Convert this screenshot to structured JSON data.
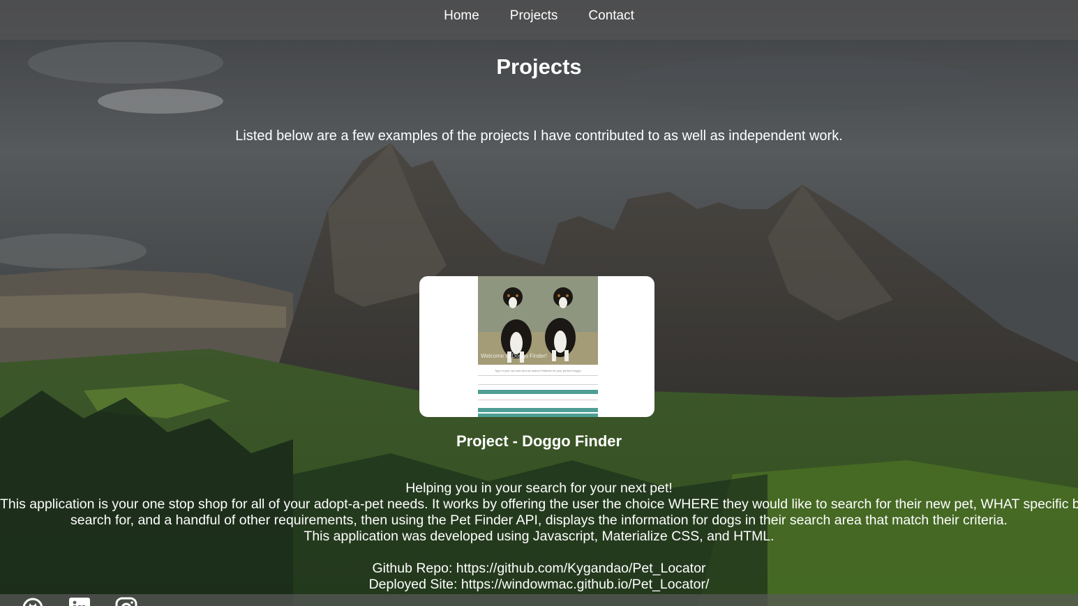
{
  "nav": {
    "items": [
      {
        "label": "Home"
      },
      {
        "label": "Projects"
      },
      {
        "label": "Contact"
      }
    ]
  },
  "page": {
    "title": "Projects",
    "intro": "Listed below are a few examples of the projects I have contributed to as well as independent work."
  },
  "project": {
    "name": "Project - Doggo Finder",
    "screenshot_caption": "Welcome to Doggo Finder!",
    "screenshot_subline": "Type in your zip code and we search Petfinder for your perfect Doggo!",
    "tagline": "Helping you in your search for your next pet!",
    "description_line1": "This application is your one stop shop for all of your adopt-a-pet needs. It works by offering the user the choice WHERE they would like to search for their new pet, WHAT specific breed they'd like to",
    "description_line2": "search for, and a handful of other requirements, then using the Pet Finder API, displays the information for dogs in their search area that match their criteria.",
    "tech": "This application was developed using Javascript, Materialize CSS, and HTML.",
    "repo_label": "Github Repo: ",
    "repo_url": "https://github.com/Kygandao/Pet_Locator",
    "site_label": "Deployed Site: ",
    "site_url": "https://windowmac.github.io/Pet_Locator/"
  },
  "footer": {
    "icons": [
      "github-icon",
      "linkedin-icon",
      "instagram-icon"
    ]
  },
  "colors": {
    "accent": "#4e9e94",
    "text": "#ffffff",
    "nav_bg": "#5a5a5a"
  }
}
